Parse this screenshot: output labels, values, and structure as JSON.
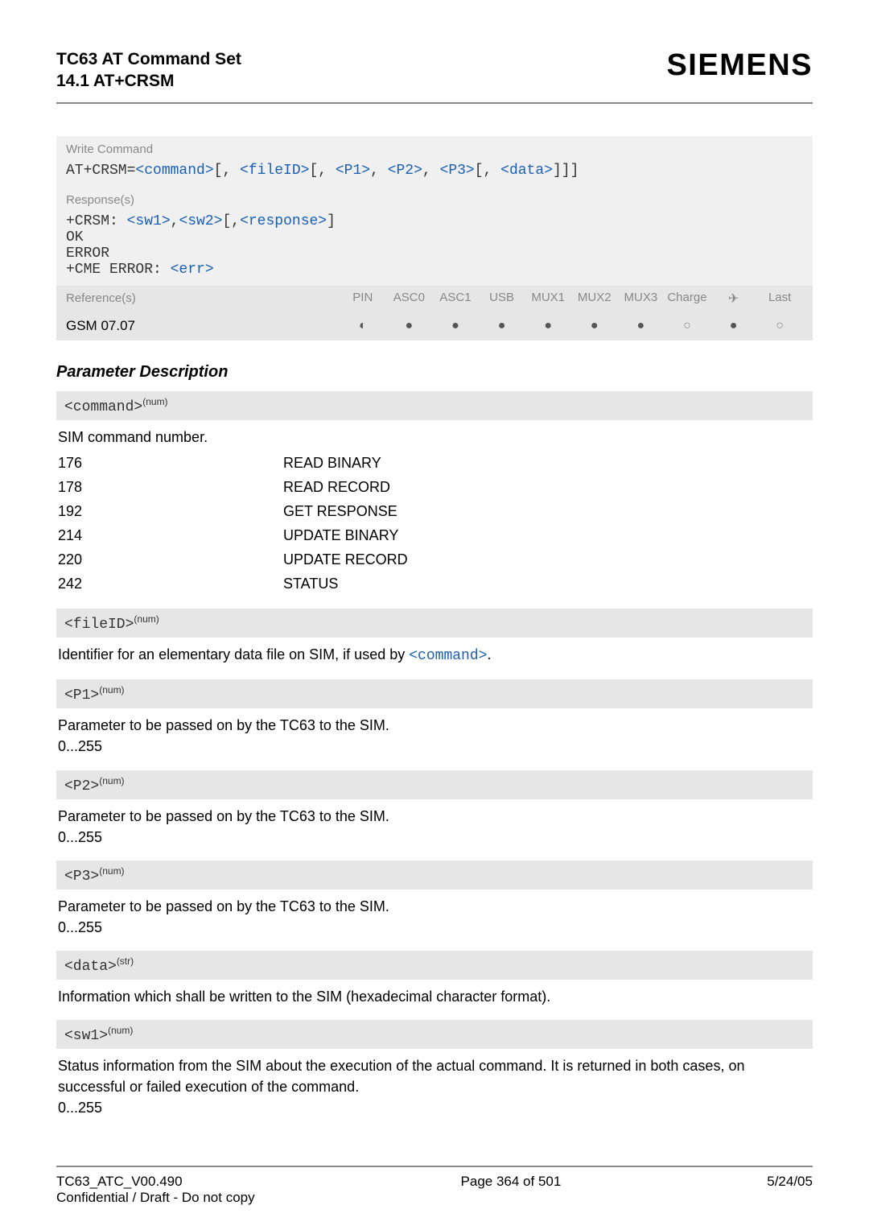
{
  "header": {
    "title_line1": "TC63 AT Command Set",
    "title_line2": "14.1 AT+CRSM",
    "brand": "SIEMENS"
  },
  "write_command": {
    "label": "Write Command",
    "prefix": "AT+CRSM=",
    "parts": [
      "<command>",
      "[, ",
      "<fileID>",
      "[, ",
      "<P1>",
      ", ",
      "<P2>",
      ", ",
      "<P3>",
      "[, ",
      "<data>",
      "]]]"
    ]
  },
  "response": {
    "label": "Response(s)",
    "line1_prefix": "+CRSM: ",
    "line1_parts": [
      "<sw1>",
      ",",
      "<sw2>",
      "[,",
      "<response>",
      "]"
    ],
    "line2": "OK",
    "line3": "ERROR",
    "line4_prefix": "+CME ERROR: ",
    "line4_link": "<err>"
  },
  "reference": {
    "label": "Reference(s)",
    "columns": [
      "PIN",
      "ASC0",
      "ASC1",
      "USB",
      "MUX1",
      "MUX2",
      "MUX3",
      "Charge",
      "✈",
      "Last"
    ],
    "value": "GSM 07.07",
    "dots": [
      "◐",
      "●",
      "●",
      "●",
      "●",
      "●",
      "●",
      "○",
      "●",
      "○"
    ]
  },
  "param_desc_title": "Parameter Description",
  "params": {
    "command": {
      "head": "<command>",
      "sup": "(num)",
      "desc": "SIM command number.",
      "rows": [
        {
          "k": "176",
          "v": "READ BINARY"
        },
        {
          "k": "178",
          "v": "READ RECORD"
        },
        {
          "k": "192",
          "v": "GET RESPONSE"
        },
        {
          "k": "214",
          "v": "UPDATE BINARY"
        },
        {
          "k": "220",
          "v": "UPDATE RECORD"
        },
        {
          "k": "242",
          "v": "STATUS"
        }
      ]
    },
    "fileID": {
      "head": "<fileID>",
      "sup": "(num)",
      "desc_pre": "Identifier for an elementary data file on SIM, if used by ",
      "desc_link": "<command>",
      "desc_post": "."
    },
    "P1": {
      "head": "<P1>",
      "sup": "(num)",
      "desc": "Parameter to be passed on by the TC63 to the SIM.",
      "range": "0...255"
    },
    "P2": {
      "head": "<P2>",
      "sup": "(num)",
      "desc": "Parameter to be passed on by the TC63 to the SIM.",
      "range": "0...255"
    },
    "P3": {
      "head": "<P3>",
      "sup": "(num)",
      "desc": "Parameter to be passed on by the TC63 to the SIM.",
      "range": "0...255"
    },
    "data": {
      "head": "<data>",
      "sup": "(str)",
      "desc": "Information which shall be written to the SIM (hexadecimal character format)."
    },
    "sw1": {
      "head": "<sw1>",
      "sup": "(num)",
      "desc": "Status information from the SIM about the execution of the actual command. It is returned in both cases, on successful or failed execution of the command.",
      "range": "0...255"
    }
  },
  "footer": {
    "left_line1": "TC63_ATC_V00.490",
    "left_line2": "Confidential / Draft - Do not copy",
    "center": "Page 364 of 501",
    "right": "5/24/05"
  }
}
